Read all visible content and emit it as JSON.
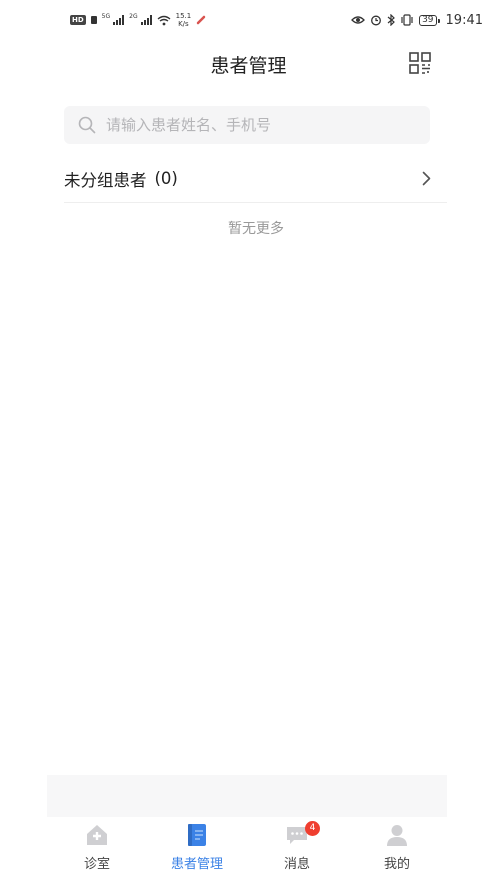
{
  "status_bar": {
    "hd": "HD",
    "net1": "5G",
    "net2": "2G",
    "speed_value": "15.1",
    "speed_unit": "K/s",
    "battery": "39",
    "time": "19:41"
  },
  "header": {
    "title": "患者管理"
  },
  "search": {
    "placeholder": "请输入患者姓名、手机号",
    "value": ""
  },
  "groups": [
    {
      "name": "未分组患者",
      "count": "(0)"
    }
  ],
  "list_footer": "暂无更多",
  "tab_bar": {
    "tabs": [
      {
        "label": "诊室",
        "icon": "clinic-house-icon",
        "active": false
      },
      {
        "label": "患者管理",
        "icon": "patient-notebook-icon",
        "active": true
      },
      {
        "label": "消息",
        "icon": "message-bubble-icon",
        "active": false,
        "badge": "4"
      },
      {
        "label": "我的",
        "icon": "profile-person-icon",
        "active": false
      }
    ]
  },
  "colors": {
    "accent": "#3b82e6",
    "badge": "#ef3e2f",
    "search_bg": "#f5f5f6",
    "placeholder": "#b5b5b8",
    "muted_text": "#999999"
  }
}
